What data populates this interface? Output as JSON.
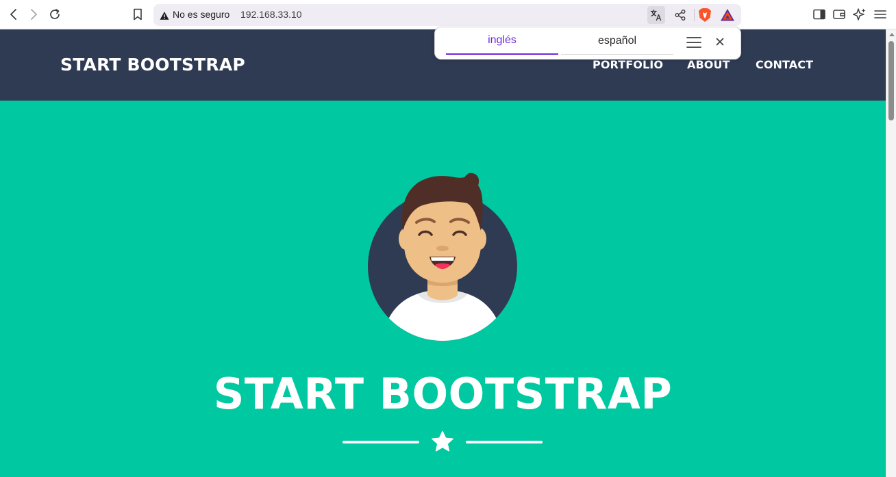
{
  "browser": {
    "security_label": "No es seguro",
    "url": "192.168.33.10",
    "icons": [
      "back-icon",
      "forward-icon",
      "reload-icon",
      "bookmark-icon",
      "warning-icon",
      "translate-icon",
      "share-icon",
      "brave-shields-icon",
      "brave-rewards-icon",
      "sidebar-icon",
      "wallet-icon",
      "leo-ai-icon",
      "menu-icon"
    ]
  },
  "translate_bubble": {
    "tabs": [
      {
        "label": "inglés",
        "active": true
      },
      {
        "label": "español",
        "active": false
      }
    ],
    "accent_color": "#6e2bd9"
  },
  "site": {
    "brand": "START BOOTSTRAP",
    "nav": [
      "PORTFOLIO",
      "ABOUT",
      "CONTACT"
    ],
    "masthead_title": "START BOOTSTRAP",
    "nav_color": "#2f3b53",
    "masthead_color": "#00c9a1",
    "divider_icon": "star-icon"
  }
}
